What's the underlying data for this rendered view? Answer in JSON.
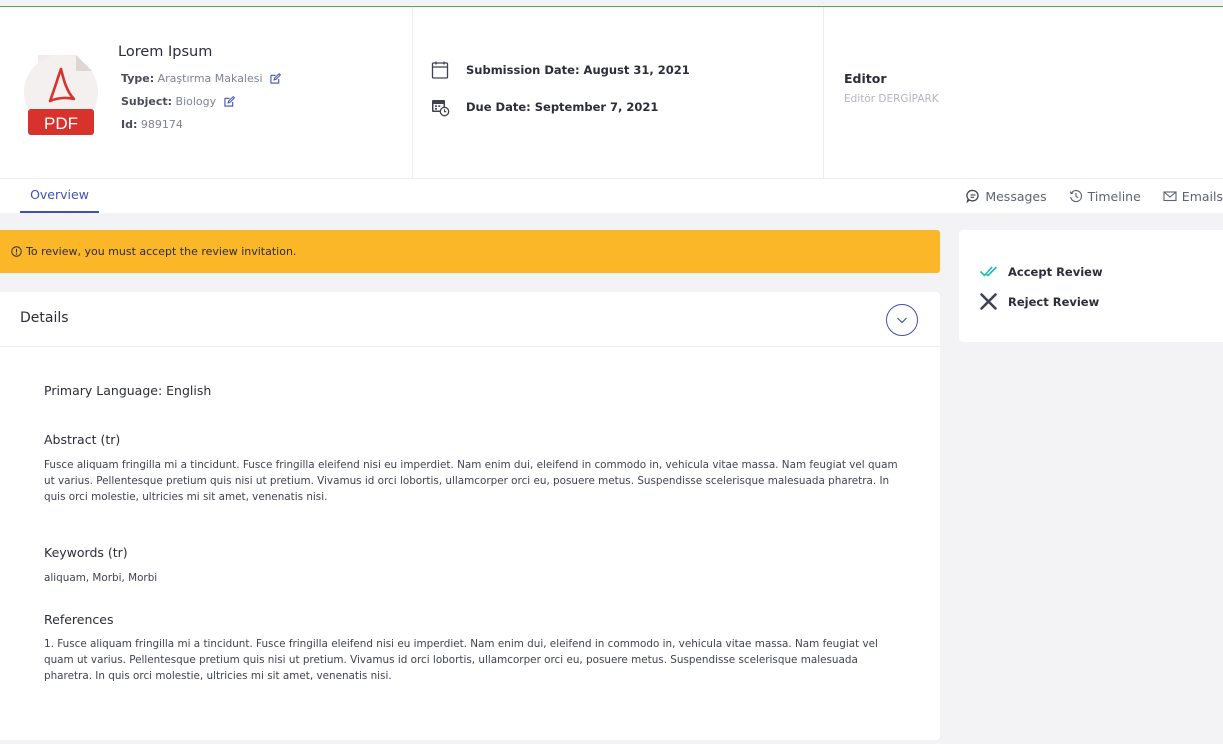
{
  "submission": {
    "title": "Lorem Ipsum",
    "type_label": "Type:",
    "type_value": "Araştırma Makalesi",
    "subject_label": "Subject:",
    "subject_value": "Biology",
    "id_label": "Id:",
    "id_value": "989174",
    "file_badge": "PDF"
  },
  "dates": {
    "submission": "Submission Date: August 31, 2021",
    "due": "Due Date: September 7, 2021"
  },
  "editor": {
    "title": "Editor",
    "name": "Editör DERGİPARK"
  },
  "tabs": {
    "overview": "Overview",
    "messages": "Messages",
    "timeline": "Timeline",
    "emails": "Emails"
  },
  "warning": {
    "text": "To review, you must accept the review invitation."
  },
  "details": {
    "title": "Details",
    "primary_language": "Primary Language: English",
    "abstract_heading": "Abstract (tr)",
    "abstract_text": "Fusce aliquam fringilla mi a tincidunt. Fusce fringilla eleifend nisi eu imperdiet. Nam enim dui, eleifend in commodo in, vehicula vitae massa. Nam feugiat vel quam ut varius. Pellentesque pretium quis nisi ut pretium. Vivamus id orci lobortis, ullamcorper orci eu, posuere metus. Suspendisse scelerisque malesuada pharetra. In quis orci molestie, ultricies mi sit amet, venenatis nisi.",
    "keywords_heading": "Keywords (tr)",
    "keywords_text": "aliquam, Morbi, Morbi",
    "references_heading": "References",
    "references_text": "1. Fusce aliquam fringilla mi a tincidunt. Fusce fringilla eleifend nisi eu imperdiet. Nam enim dui, eleifend in commodo in, vehicula vitae massa. Nam feugiat vel quam ut varius. Pellentesque pretium quis nisi ut pretium. Vivamus id orci lobortis, ullamcorper orci eu, posuere metus. Suspendisse scelerisque malesuada pharetra. In quis orci molestie, ultricies mi sit amet, venenatis nisi."
  },
  "actions": {
    "accept": "Accept Review",
    "reject": "Reject Review"
  },
  "icons": {
    "file": "pdf-file-icon",
    "edit": "edit-icon",
    "calendar": "calendar-icon",
    "due_calendar": "calendar-clock-icon",
    "messages": "chat-bubble-icon",
    "timeline": "clock-icon",
    "emails": "envelope-icon",
    "info": "info-icon",
    "collapse": "chevron-down-icon",
    "accept": "double-check-icon",
    "reject": "x-icon"
  },
  "colors": {
    "accent": "#3f51b5",
    "warning": "#fbb728",
    "pdf_red": "#d8322c",
    "accept_teal": "#20c0b5",
    "top_line": "#4caf50"
  }
}
